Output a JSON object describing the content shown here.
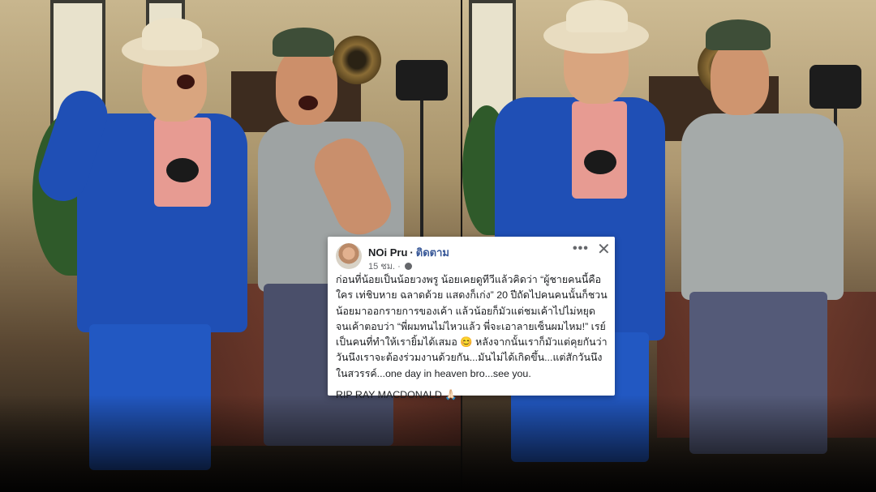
{
  "post": {
    "author": "NOi Pru",
    "separator": "·",
    "follow_label": "ติดตาม",
    "time": "15 ชม. ·",
    "more_label": "•••",
    "close_label": "✕",
    "body_text": "ก่อนที่น้อยเป็นน้อยวงพรู น้อยเคยดูทีวีแล้วคิดว่า “ผู้ชายคนนี้คือใคร เท่ชิบหาย ฉลาดด้วย แสดงก็เก่ง” 20 ปีถัดไปคนคนนั้นก็ชวนน้อยมาออกรายการของเค้า แล้วน้อยก็มัวแต่ชมเค้าไปไม่หยุด จนเค้าตอบว่า “พี่ผมทนไม่ไหวแล้ว พี่จะเอาลายเซ็นผมไหม!” เรย์เป็นคนที่ทำให้เรายิ้มได้เสมอ 😊 หลังจากนั้นเราก็มัวแต่คุยกันว่าวันนึงเราจะต้องร่วมงานด้วยกัน...มันไม่ได้เกิดขึ้น...แต่สักวันนึงในสวรรค์...one day in heaven bro...see you.",
    "signoff": "RIP RAY MACDONALD 🙏🏻"
  },
  "colors": {
    "link": "#385898",
    "card_bg": "#ffffff",
    "muted": "#65676b"
  }
}
